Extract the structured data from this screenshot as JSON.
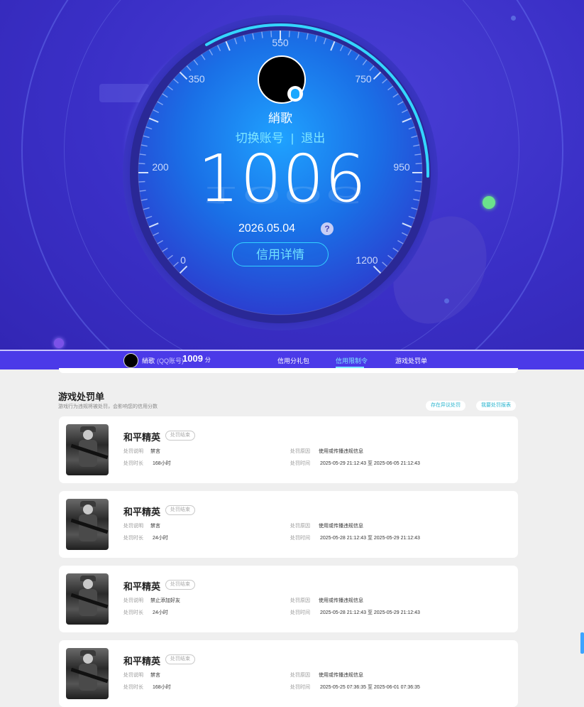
{
  "hero": {
    "nickname": "綃歌",
    "switch_account": "切换账号",
    "separator": "|",
    "logout": "退出",
    "score": "1006",
    "date": "2026.05.04",
    "help": "?",
    "detail_button": "信用详情",
    "gauge": {
      "min": 0,
      "max": 1200,
      "value": 1006,
      "ticks": [
        "0",
        "200",
        "350",
        "550",
        "750",
        "950",
        "1200"
      ]
    }
  },
  "navbar": {
    "nickname": "綃歌",
    "account_type": "(QQ账号)",
    "score": "1009",
    "score_unit": "分",
    "tabs": [
      "信用分礼包",
      "信用限制令",
      "游戏处罚单"
    ],
    "active_tab": "信用限制令"
  },
  "section": {
    "title": "游戏处罚单",
    "subtitle": "游戏行为违规将被处罚，会影响您的信用分数",
    "btn_appeal": "存在异议处罚",
    "btn_report": "我要处罚报表"
  },
  "cards": [
    {
      "game": "和平精英",
      "status": "处罚结束",
      "desc_label": "处罚说明",
      "desc": "禁言",
      "reason_label": "处罚原因",
      "reason": "使用或传播违规信息",
      "dur_label": "处罚时长",
      "duration": "168小时",
      "time_label": "处罚时间",
      "time": "2025-05-29 21:12:43 至 2025-06-05 21:12:43"
    },
    {
      "game": "和平精英",
      "status": "处罚结束",
      "desc_label": "处罚说明",
      "desc": "禁言",
      "reason_label": "处罚原因",
      "reason": "使用或传播违规信息",
      "dur_label": "处罚时长",
      "duration": "24小时",
      "time_label": "处罚时间",
      "time": "2025-05-28 21:12:43 至 2025-05-29 21:12:43"
    },
    {
      "game": "和平精英",
      "status": "处罚结束",
      "desc_label": "处罚说明",
      "desc": "禁止添加好友",
      "reason_label": "处罚原因",
      "reason": "使用或传播违规信息",
      "dur_label": "处罚时长",
      "duration": "24小时",
      "time_label": "处罚时间",
      "time": "2025-05-28 21:12:43 至 2025-05-29 21:12:43"
    },
    {
      "game": "和平精英",
      "status": "处罚结束",
      "desc_label": "处罚说明",
      "desc": "禁言",
      "reason_label": "处罚原因",
      "reason": "使用或传播违规信息",
      "dur_label": "处罚时长",
      "duration": "168小时",
      "time_label": "处罚时间",
      "time": "2025-05-25 07:36:35 至 2025-06-01 07:36:35"
    }
  ],
  "colors": {
    "hero_bg": "#3a2fc6",
    "accent_cyan": "#33d2ff",
    "navbar_bg": "#4b3ae8",
    "green_dot": "#6be28c"
  }
}
